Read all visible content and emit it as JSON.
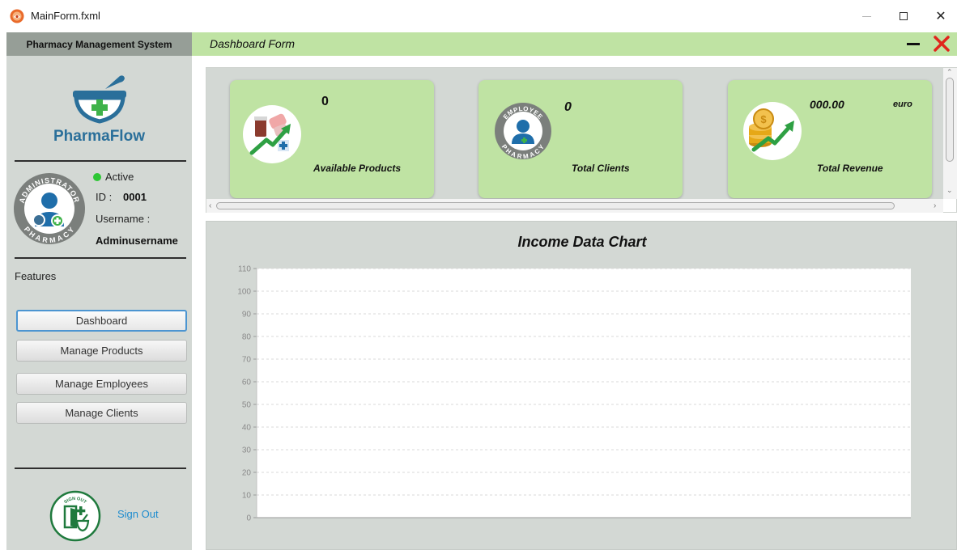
{
  "window": {
    "title": "MainForm.fxml",
    "close_glyph": "✕"
  },
  "sidebar": {
    "header": "Pharmacy Management System",
    "logo_text": "PharmaFlow",
    "avatar_badge_top": "ADMINISTRATOR",
    "avatar_badge_bottom": "PHARMACY",
    "user": {
      "status": "Active",
      "id_label": "ID :",
      "id_value": "0001",
      "username_label": "Username :",
      "username_value": "Adminusername"
    },
    "features_label": "Features",
    "nav": [
      {
        "label": "Dashboard",
        "active": true
      },
      {
        "label": "Manage Products",
        "active": false
      },
      {
        "label": "Manage Employees",
        "active": false
      },
      {
        "label": "Manage Clients",
        "active": false
      }
    ],
    "signout_badge": "SIGN OUT",
    "signout_label": "Sign Out"
  },
  "main": {
    "title": "Dashboard Form",
    "cards": [
      {
        "value": "0",
        "label": "Available Products",
        "icon": "pills-growth-icon"
      },
      {
        "value": "0",
        "label": "Total Clients",
        "icon": "employee-badge-icon",
        "badge_top": "EMPLOYEE",
        "badge_bottom": "PHARMACY"
      },
      {
        "value": "000.00",
        "unit": "euro",
        "label": "Total Revenue",
        "icon": "coins-growth-icon"
      }
    ],
    "scroll": {
      "left": "‹",
      "right": "›",
      "up": "⌃",
      "down": "⌄"
    }
  },
  "colors": {
    "accent_green": "#bfe3a3",
    "sidebar_bg": "#d3d8d4",
    "sidebar_header": "#969e97",
    "logo_blue": "#2a6f9a",
    "cross_green": "#3fb24a",
    "close_red": "#e0261c",
    "status_active": "#2ec735",
    "link_blue": "#1d8ccf"
  },
  "chart_data": {
    "type": "bar",
    "title": "Income Data Chart",
    "categories": [],
    "values": [],
    "y_ticks": [
      "110",
      "100",
      "90",
      "80",
      "70",
      "60",
      "50",
      "40",
      "30",
      "20",
      "10",
      "0"
    ],
    "ylim": [
      0,
      110
    ],
    "grid": true,
    "legend": "none"
  }
}
